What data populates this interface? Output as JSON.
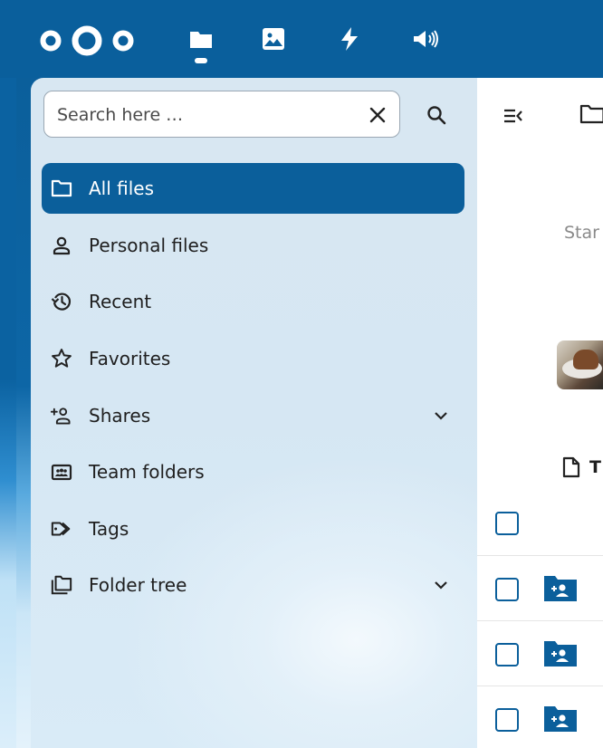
{
  "header": {
    "apps": [
      {
        "name": "files",
        "icon": "folder-icon"
      },
      {
        "name": "photos",
        "icon": "image-icon"
      },
      {
        "name": "activity",
        "icon": "bolt-icon"
      },
      {
        "name": "announcements",
        "icon": "megaphone-icon"
      }
    ]
  },
  "sidebar": {
    "search": {
      "placeholder": "Search here …",
      "value": ""
    },
    "items": [
      {
        "label": "All files",
        "icon": "folder-icon",
        "active": true
      },
      {
        "label": "Personal files",
        "icon": "user-icon"
      },
      {
        "label": "Recent",
        "icon": "history-icon"
      },
      {
        "label": "Favorites",
        "icon": "star-icon"
      },
      {
        "label": "Shares",
        "icon": "share-user-icon",
        "expandable": true
      },
      {
        "label": "Team folders",
        "icon": "team-folder-icon"
      },
      {
        "label": "Tags",
        "icon": "tag-icon"
      },
      {
        "label": "Folder tree",
        "icon": "folder-multiple-icon",
        "expandable": true
      }
    ]
  },
  "main": {
    "partial_text": "Star",
    "file_header_letter": "T"
  },
  "colors": {
    "primary": "#0b5f9b",
    "header": "#0a5f9c",
    "sidebar_bg": "#d8e7f2"
  }
}
